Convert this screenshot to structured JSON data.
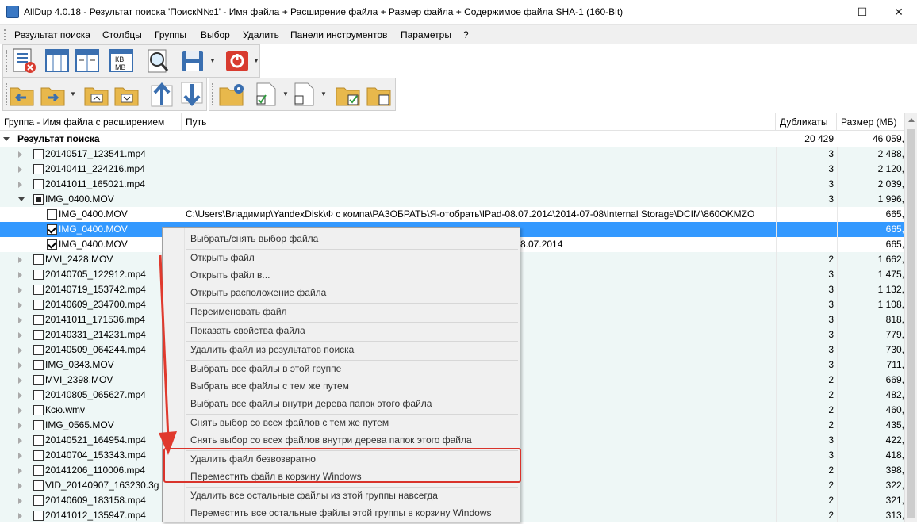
{
  "window": {
    "title": "AllDup 4.0.18 - Результат поиска 'ПоискN№1' - Имя файла + Расширение файла + Размер файла + Содержимое файла SHA-1 (160-Bit)",
    "minimize": "—",
    "maximize": "☐",
    "close": "✕"
  },
  "menu": [
    "Результат поиска",
    "Столбцы",
    "Группы",
    "Выбор",
    "Удалить",
    "Панели инструментов",
    "Параметры",
    "?"
  ],
  "columns": {
    "name": "Группа - Имя файла с расширением",
    "path": "Путь",
    "dups": "Дубликаты",
    "size": "Размер (МБ)"
  },
  "summary": {
    "label": "Результат поиска",
    "dups": "20 429",
    "size": "46 059,"
  },
  "rows": [
    {
      "type": "group",
      "name": "20140517_123541.mp4",
      "dups": "3",
      "size": "2 488,"
    },
    {
      "type": "group",
      "name": "20140411_224216.mp4",
      "dups": "3",
      "size": "2 120,"
    },
    {
      "type": "group",
      "name": "20141011_165021.mp4",
      "dups": "3",
      "size": "2 039,"
    },
    {
      "type": "group-open",
      "name": "IMG_0400.MOV",
      "dups": "3",
      "size": "1 996,"
    },
    {
      "type": "file",
      "name": "IMG_0400.MOV",
      "path": "C:\\Users\\Владимир\\YandexDisk\\Ф с компа\\РАЗОБРАТЬ\\Я-отобрать\\IPad-08.07.2014\\2014-07-08\\Internal Storage\\DCIM\\860OKMZO",
      "dups": "",
      "size": "665,",
      "checked": false
    },
    {
      "type": "file-sel",
      "name": "IMG_0400.MOV",
      "path": "",
      "dups": "",
      "size": "665,",
      "checked": true
    },
    {
      "type": "file",
      "name": "IMG_0400.MOV",
      "path": "8.07.2014",
      "dups": "",
      "size": "665,",
      "checked": true
    },
    {
      "type": "group",
      "name": "MVI_2428.MOV",
      "dups": "2",
      "size": "1 662,"
    },
    {
      "type": "group",
      "name": "20140705_122912.mp4",
      "dups": "3",
      "size": "1 475,"
    },
    {
      "type": "group",
      "name": "20140719_153742.mp4",
      "dups": "3",
      "size": "1 132,"
    },
    {
      "type": "group",
      "name": "20140609_234700.mp4",
      "dups": "3",
      "size": "1 108,"
    },
    {
      "type": "group",
      "name": "20141011_171536.mp4",
      "dups": "3",
      "size": "818,"
    },
    {
      "type": "group",
      "name": "20140331_214231.mp4",
      "dups": "3",
      "size": "779,"
    },
    {
      "type": "group",
      "name": "20140509_064244.mp4",
      "dups": "3",
      "size": "730,"
    },
    {
      "type": "group",
      "name": "IMG_0343.MOV",
      "dups": "3",
      "size": "711,"
    },
    {
      "type": "group",
      "name": "MVI_2398.MOV",
      "dups": "2",
      "size": "669,"
    },
    {
      "type": "group",
      "name": "20140805_065627.mp4",
      "dups": "2",
      "size": "482,"
    },
    {
      "type": "group",
      "name": "Ксю.wmv",
      "dups": "2",
      "size": "460,"
    },
    {
      "type": "group",
      "name": "IMG_0565.MOV",
      "dups": "2",
      "size": "435,"
    },
    {
      "type": "group",
      "name": "20140521_164954.mp4",
      "dups": "3",
      "size": "422,"
    },
    {
      "type": "group",
      "name": "20140704_153343.mp4",
      "dups": "3",
      "size": "418,"
    },
    {
      "type": "group",
      "name": "20141206_110006.mp4",
      "dups": "2",
      "size": "398,"
    },
    {
      "type": "group",
      "name": "VID_20140907_163230.3g",
      "dups": "2",
      "size": "322,"
    },
    {
      "type": "group",
      "name": "20140609_183158.mp4",
      "dups": "2",
      "size": "321,"
    },
    {
      "type": "group",
      "name": "20141012_135947.mp4",
      "dups": "2",
      "size": "313,"
    }
  ],
  "context_menu": [
    {
      "label": "Выбрать/снять выбор файла",
      "sep_after": true
    },
    {
      "label": "Открыть файл",
      "sep_after": false
    },
    {
      "label": "Открыть файл в...",
      "sep_after": false
    },
    {
      "label": "Открыть расположение файла",
      "sep_after": true
    },
    {
      "label": "Переименовать файл",
      "sep_after": true
    },
    {
      "label": "Показать свойства файла",
      "sep_after": true
    },
    {
      "label": "Удалить файл из результатов поиска",
      "sep_after": true
    },
    {
      "label": "Выбрать все файлы в этой группе",
      "sep_after": false
    },
    {
      "label": "Выбрать все файлы с тем же путем",
      "sep_after": false
    },
    {
      "label": "Выбрать все файлы внутри дерева папок этого файла",
      "sep_after": true
    },
    {
      "label": "Снять выбор со всех файлов с тем же путем",
      "sep_after": false
    },
    {
      "label": "Снять выбор со всех файлов внутри дерева папок этого файла",
      "sep_after": true
    },
    {
      "label": "Удалить файл безвозвратно",
      "sep_after": false
    },
    {
      "label": "Переместить файл в корзину Windows",
      "sep_after": true
    },
    {
      "label": "Удалить все остальные файлы из этой группы навсегда",
      "sep_after": false
    },
    {
      "label": "Переместить все остальные файлы этой группы в корзину Windows",
      "sep_after": true
    }
  ],
  "colors": {
    "selection": "#3399ff",
    "teal_row": "#eef7f6",
    "highlight": "#d9332b"
  }
}
